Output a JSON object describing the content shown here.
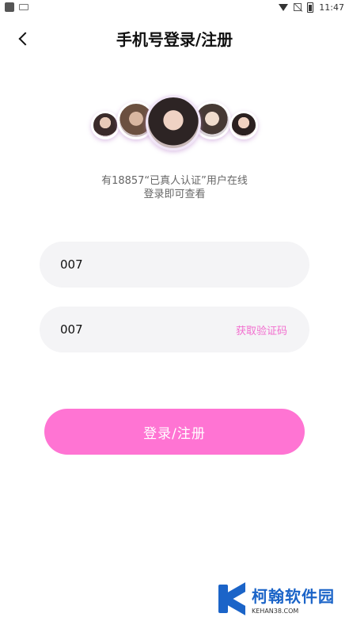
{
  "status_bar": {
    "time": "11:47",
    "icons": [
      "app-square-icon",
      "keyboard-icon",
      "wifi-icon",
      "no-signal-icon",
      "battery-icon"
    ]
  },
  "header": {
    "title": "手机号登录/注册",
    "back_icon": "chevron-left-icon"
  },
  "intro": {
    "line1": "有18857“已真人认证”用户在线",
    "line2": "登录即可查看"
  },
  "form": {
    "phone_value": "007",
    "code_value": "007",
    "get_code_label": "获取验证码",
    "login_label": "登录/注册"
  },
  "colors": {
    "accent": "#ff74d3",
    "get_code_text": "#f26fcf",
    "input_bg": "#f4f4f6",
    "watermark_blue": "#1b64c8"
  },
  "watermark": {
    "name": "柯翰软件园",
    "url": "KEHAN38.COM"
  }
}
